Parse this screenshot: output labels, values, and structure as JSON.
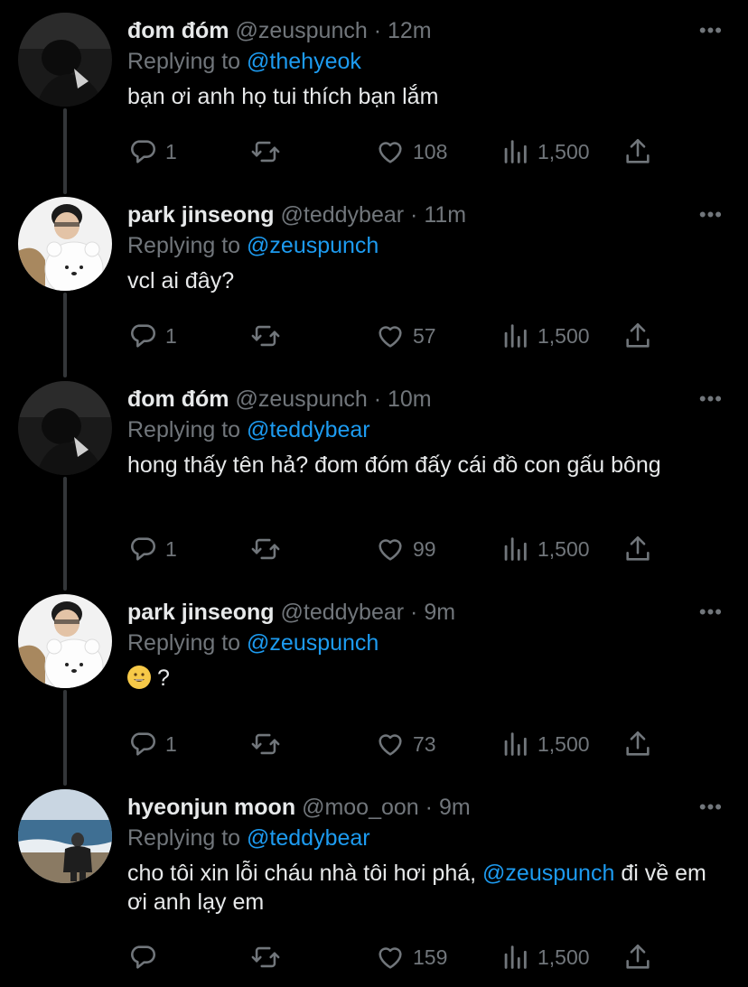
{
  "tweets": [
    {
      "name": "đom đóm",
      "handle": "@zeuspunch",
      "time": "12m",
      "replying_prefix": "Replying to",
      "replying_to": "@thehyeok",
      "text": "bạn ơi anh họ tui thích bạn lắm",
      "replies": "1",
      "likes": "108",
      "views": "1,500"
    },
    {
      "name": "park jinseong",
      "handle": "@teddybear",
      "time": "11m",
      "replying_prefix": "Replying to",
      "replying_to": "@zeuspunch",
      "text": "vcl ai đây?",
      "replies": "1",
      "likes": "57",
      "views": "1,500"
    },
    {
      "name": "đom đóm",
      "handle": "@zeuspunch",
      "time": "10m",
      "replying_prefix": "Replying to",
      "replying_to": "@teddybear",
      "text": "hong thấy tên hả? đom đóm đấy cái đồ con gấu bông",
      "replies": "1",
      "likes": "99",
      "views": "1,500"
    },
    {
      "name": "park jinseong",
      "handle": "@teddybear",
      "time": "9m",
      "replying_prefix": "Replying to",
      "replying_to": "@zeuspunch",
      "text": "?",
      "replies": "1",
      "likes": "73",
      "views": "1,500"
    },
    {
      "name": "hyeonjun moon",
      "handle": "@moo_oon",
      "time": "9m",
      "replying_prefix": "Replying to",
      "replying_to": "@teddybear",
      "text_before": "cho tôi xin lỗi cháu nhà tôi hơi phá,",
      "text_mention": "@zeuspunch",
      "text_after": "đi về em ơi anh lạy em",
      "replies": "",
      "likes": "159",
      "views": "1,500"
    }
  ],
  "icons": {
    "reply": "reply-icon",
    "retweet": "retweet-icon",
    "like": "heart-icon",
    "views": "views-icon",
    "share": "share-icon",
    "more": "more-icon"
  },
  "colors": {
    "background": "#000000",
    "text": "#e7e9ea",
    "muted": "#71767b",
    "accent": "#1d9bf0",
    "thread_line": "#333639"
  }
}
